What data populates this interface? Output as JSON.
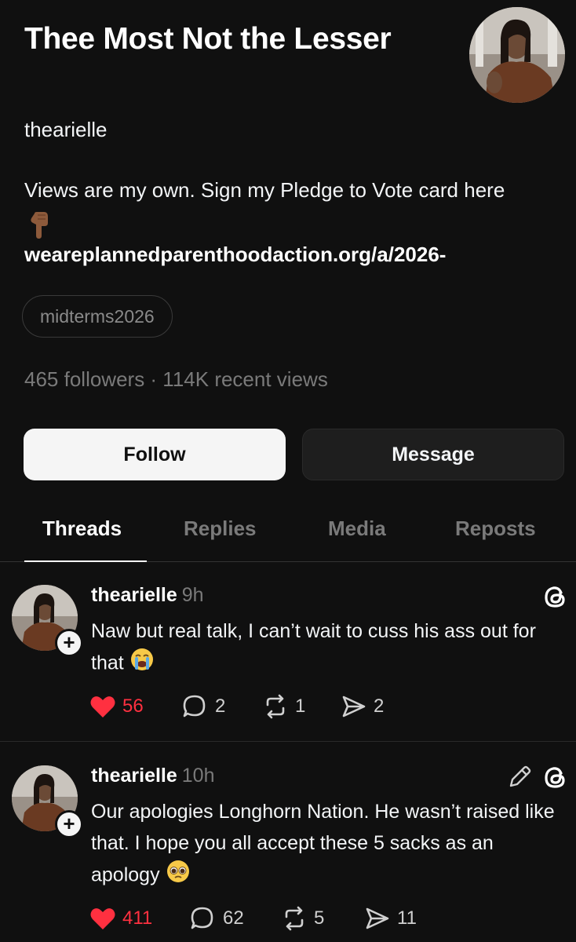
{
  "profile": {
    "name": "Thee Most Not the Lesser",
    "handle": "thearielle",
    "bio": "Views are my own. Sign my Pledge to Vote card here",
    "bio_emoji": "pointing-down-emoji",
    "link": "weareplannedparenthoodaction.org/a/2026-",
    "tag": "midterms2026",
    "stats": "465 followers · 114K recent views"
  },
  "buttons": {
    "follow": "Follow",
    "message": "Message"
  },
  "tabs": [
    {
      "label": "Threads",
      "active": true
    },
    {
      "label": "Replies",
      "active": false
    },
    {
      "label": "Media",
      "active": false
    },
    {
      "label": "Reposts",
      "active": false
    }
  ],
  "posts": [
    {
      "username": "thearielle",
      "time": "9h",
      "text": "Naw but real talk, I can’t wait to cuss his ass out for that",
      "emoji": "loudly-crying-face-emoji",
      "likes": "56",
      "replies": "2",
      "reposts": "1",
      "shares": "2"
    },
    {
      "username": "thearielle",
      "time": "10h",
      "text": "Our apologies Longhorn Nation. He wasn’t raised like that. I hope you all accept these 5 sacks as an apology",
      "emoji": "pleading-face-emoji",
      "likes": "411",
      "replies": "62",
      "reposts": "5",
      "shares": "11"
    }
  ],
  "colors": {
    "background": "#101010",
    "like": "#ff3040",
    "muted": "#7a7a7a"
  }
}
